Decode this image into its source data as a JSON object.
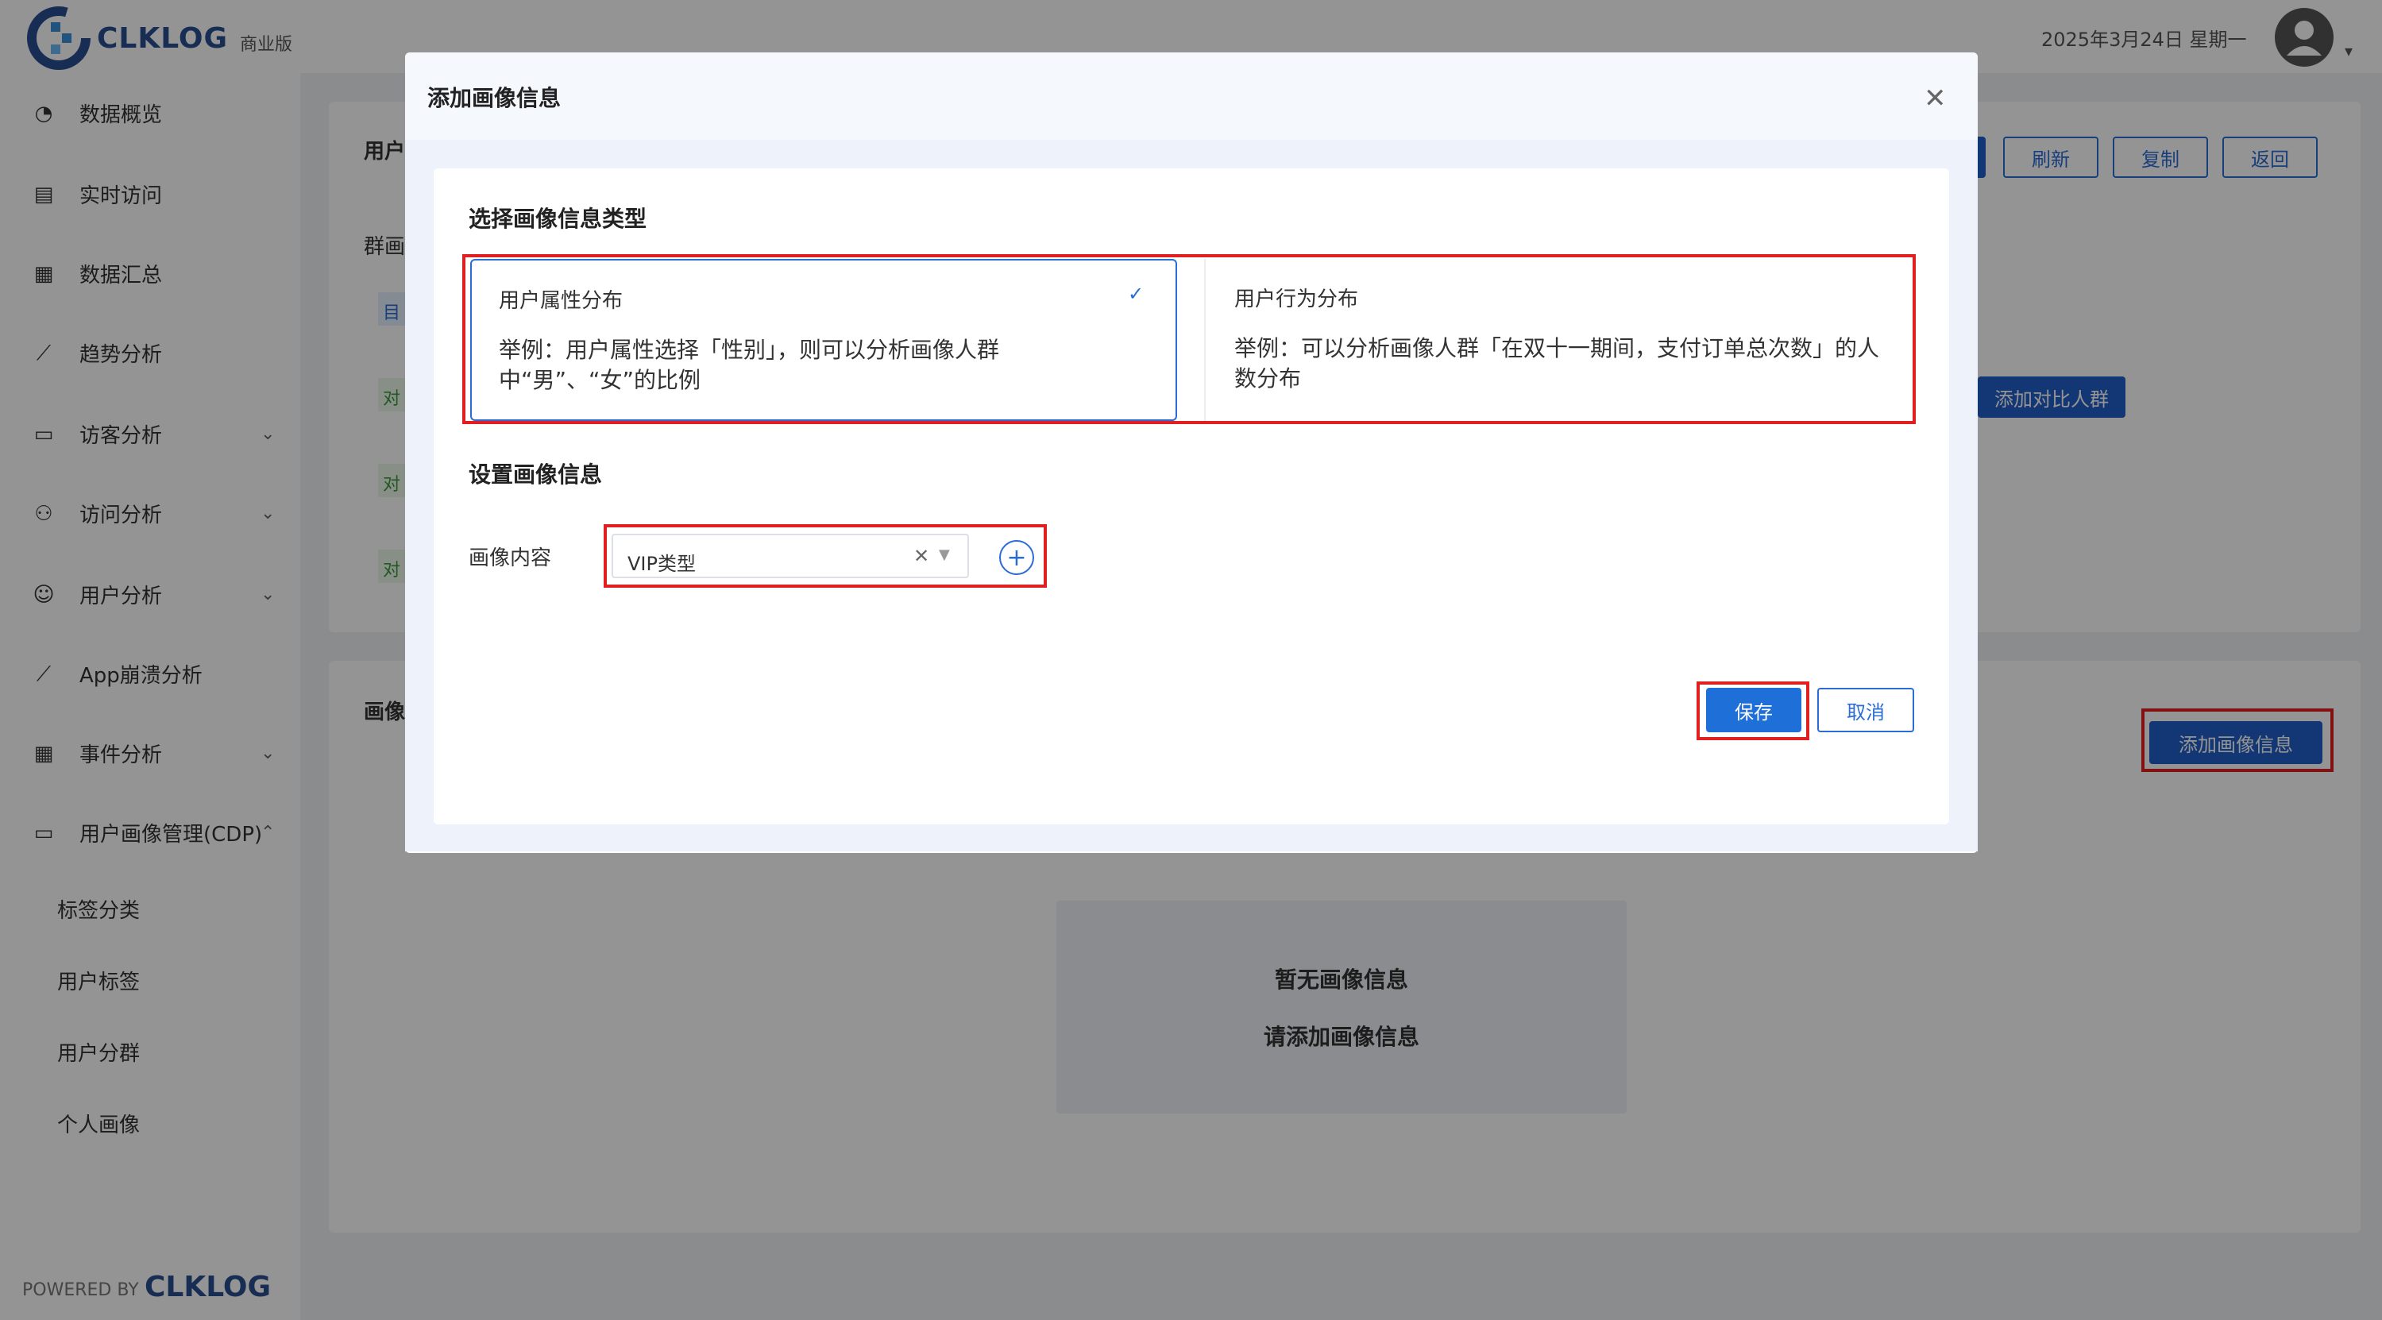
{
  "header": {
    "brand": "CLKLOG",
    "edition": "商业版",
    "date": "2025年3月24日 星期一"
  },
  "sidebar": {
    "items": [
      {
        "label": "数据概览",
        "icon": "dashboard-icon"
      },
      {
        "label": "实时访问",
        "icon": "realtime-icon"
      },
      {
        "label": "数据汇总",
        "icon": "summary-icon"
      },
      {
        "label": "趋势分析",
        "icon": "trend-icon"
      },
      {
        "label": "访客分析",
        "icon": "visitor-icon"
      },
      {
        "label": "访问分析",
        "icon": "visit-icon"
      },
      {
        "label": "用户分析",
        "icon": "user-icon"
      },
      {
        "label": "App崩溃分析",
        "icon": "crash-icon"
      },
      {
        "label": "事件分析",
        "icon": "event-icon"
      },
      {
        "label": "用户画像管理(CDP)",
        "icon": "cdp-icon"
      }
    ],
    "subitems": [
      "标签分类",
      "用户标签",
      "用户分群",
      "个人画像"
    ],
    "powered_by": "POWERED BY",
    "powered_brand": "CLKLOG"
  },
  "background": {
    "card1_title": "用户",
    "card1_label": "群画",
    "tag1": "目",
    "tag_compare": "对",
    "toolbar": {
      "refresh": "刷新",
      "copy": "复制",
      "back": "返回"
    },
    "add_compare": "添加对比人群",
    "card2_title": "画像",
    "add_profile": "添加画像信息",
    "empty_title": "暂无画像信息",
    "empty_hint": "请添加画像信息"
  },
  "modal": {
    "title": "添加画像信息",
    "section1_title": "选择画像信息类型",
    "option1": {
      "title": "用户属性分布",
      "desc": "举例：用户属性选择「性别」，则可以分析画像人群中“男”、“女”的比例",
      "selected": true
    },
    "option2": {
      "title": "用户行为分布",
      "desc": "举例：可以分析画像人群「在双十一期间，支付订单总次数」的人数分布"
    },
    "section2_title": "设置画像信息",
    "content_label": "画像内容",
    "select_value": "VIP类型",
    "save": "保存",
    "cancel": "取消"
  },
  "colors": {
    "primary": "#1f6fd8",
    "highlight": "#e02020",
    "brand": "#2a4f8f"
  }
}
